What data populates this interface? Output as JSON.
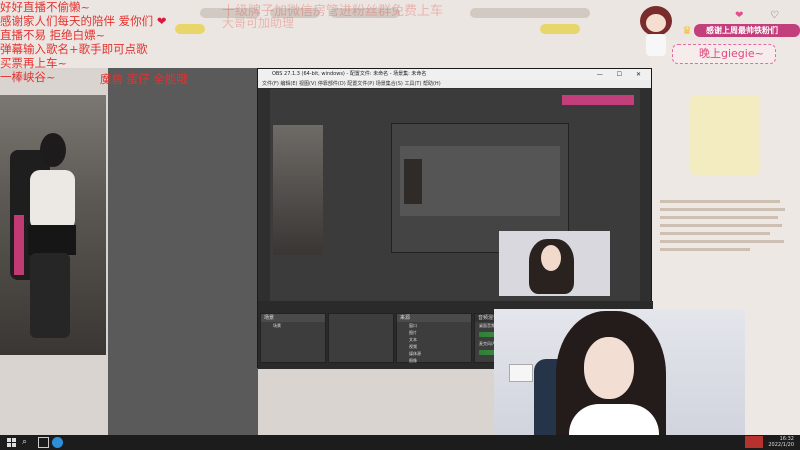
{
  "overlay": {
    "lines": [
      "好好直播不偷懒~",
      "感谢家人们每天的陪伴 爱你们",
      "直播不易 拒绝白嫖~",
      "弹幕输入歌名+歌手即可点歌",
      "买票再上车~",
      "一棒峡谷~",
      "魔兽 蛋仔 全能哦"
    ],
    "heart": "❤",
    "faint_top_1": "十级牌子加微信房管进粉丝群免费上车",
    "faint_top_2": "大哥可加助理"
  },
  "greeting": {
    "thanks_banner": "感谢上周最帅铁粉们",
    "box_text": "晚上giegie~"
  },
  "obs": {
    "title": "OBS 27.1.3 (64-bit, windows) - 配置文件: 未命名 - 场景集: 未命名",
    "menu": "文件(F)  编辑(E)  视图(V)  停靠部件(D)  配置文件(P)  场景集合(S)  工具(T)  帮助(H)",
    "window_buttons": "—  ☐  ✕",
    "scenes_header": "场景",
    "scene_item": "场景",
    "sources_header": "来源",
    "sources": [
      "窗口",
      "图片",
      "文本",
      "视频",
      "媒体源",
      "图像"
    ],
    "mixer_header": "音频混音器",
    "mixer_tracks": [
      "桌面音频",
      "麦克风/Aux"
    ]
  },
  "taskbar": {
    "search_glyph": "⌕",
    "clock": "16:32",
    "date": "2022/1/20"
  },
  "icons": {
    "crown": "crown-icon",
    "heart": "heart-icon",
    "windows": "windows-start-icon",
    "search": "search-icon",
    "edge": "edge-browser-icon"
  },
  "colors": {
    "overlay_text": "#e5312f",
    "banner_pink": "#c33f7c",
    "greeting_pink": "#e0487f"
  }
}
